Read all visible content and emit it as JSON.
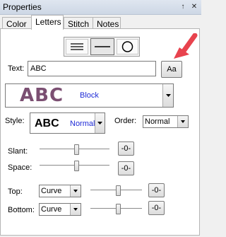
{
  "window": {
    "title": "Properties",
    "pin_glyph": "↑",
    "close_glyph": "✕"
  },
  "tabs": [
    {
      "label": "Color",
      "active": false
    },
    {
      "label": "Letters",
      "active": true
    },
    {
      "label": "Stitch",
      "active": false
    },
    {
      "label": "Notes",
      "active": false
    }
  ],
  "mode_buttons": [
    {
      "name": "multi-line",
      "active": false
    },
    {
      "name": "single-line",
      "active": true
    },
    {
      "name": "circle",
      "active": false
    }
  ],
  "text": {
    "label": "Text:",
    "value": "ABC",
    "font_button": "Aa"
  },
  "font_preview": {
    "sample": "ABC",
    "name": "Block",
    "sample_color": "#7b4f72",
    "name_color": "#1e2bd6"
  },
  "style": {
    "label": "Style:",
    "sample": "ABC",
    "value": "Normal"
  },
  "order": {
    "label": "Order:",
    "value": "Normal"
  },
  "slant": {
    "label": "Slant:",
    "level_percent": 53,
    "reset_label": "-0-"
  },
  "space": {
    "label": "Space:",
    "level_percent": 53,
    "reset_label": "-0-"
  },
  "top": {
    "label": "Top:",
    "value": "Curve",
    "level_percent": 53,
    "reset_label": "-0-"
  },
  "bottom": {
    "label": "Bottom:",
    "value": "Curve",
    "level_percent": 53,
    "reset_label": "-0-"
  },
  "colors": {
    "annotation_arrow": "#e8434e"
  }
}
